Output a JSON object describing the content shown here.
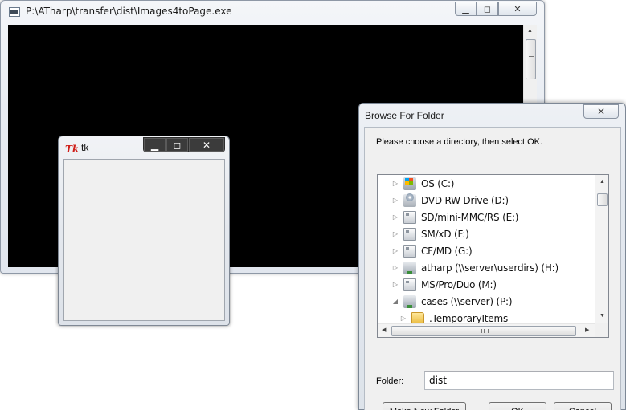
{
  "console_window": {
    "title": "P:\\ATharp\\transfer\\dist\\Images4toPage.exe",
    "buttons": {
      "minimize": "▁",
      "maximize": "◻",
      "close": "✕"
    }
  },
  "tk_window": {
    "title": "tk",
    "icon_text": "Tk",
    "buttons": {
      "minimize": "▁",
      "maximize": "◻",
      "close": "✕"
    }
  },
  "dialog": {
    "title": "Browse For Folder",
    "close": "✕",
    "instructions": "Please choose a directory, then select OK.",
    "tree_items": [
      {
        "label": "OS (C:)",
        "icon": "windows-drive-icon",
        "expander": "▷"
      },
      {
        "label": "DVD RW Drive (D:)",
        "icon": "dvd-drive-icon",
        "expander": "▷"
      },
      {
        "label": "SD/mini-MMC/RS (E:)",
        "icon": "removable-drive-icon",
        "expander": "▷"
      },
      {
        "label": "SM/xD (F:)",
        "icon": "removable-drive-icon",
        "expander": "▷"
      },
      {
        "label": "CF/MD (G:)",
        "icon": "removable-drive-icon",
        "expander": "▷"
      },
      {
        "label": "atharp (\\\\server\\userdirs) (H:)",
        "icon": "network-drive-icon",
        "expander": "▷"
      },
      {
        "label": "MS/Pro/Duo (M:)",
        "icon": "removable-drive-icon",
        "expander": "▷"
      },
      {
        "label": "cases (\\\\server) (P:)",
        "icon": "network-drive-icon",
        "expander": "◢"
      },
      {
        "label": ".TemporaryItems",
        "icon": "folder-icon",
        "expander": "▷"
      }
    ],
    "folder_label": "Folder:",
    "folder_value": "dist",
    "buttons": {
      "make_new_folder": "Make New Folder",
      "ok": "OK",
      "cancel": "Cancel"
    }
  }
}
